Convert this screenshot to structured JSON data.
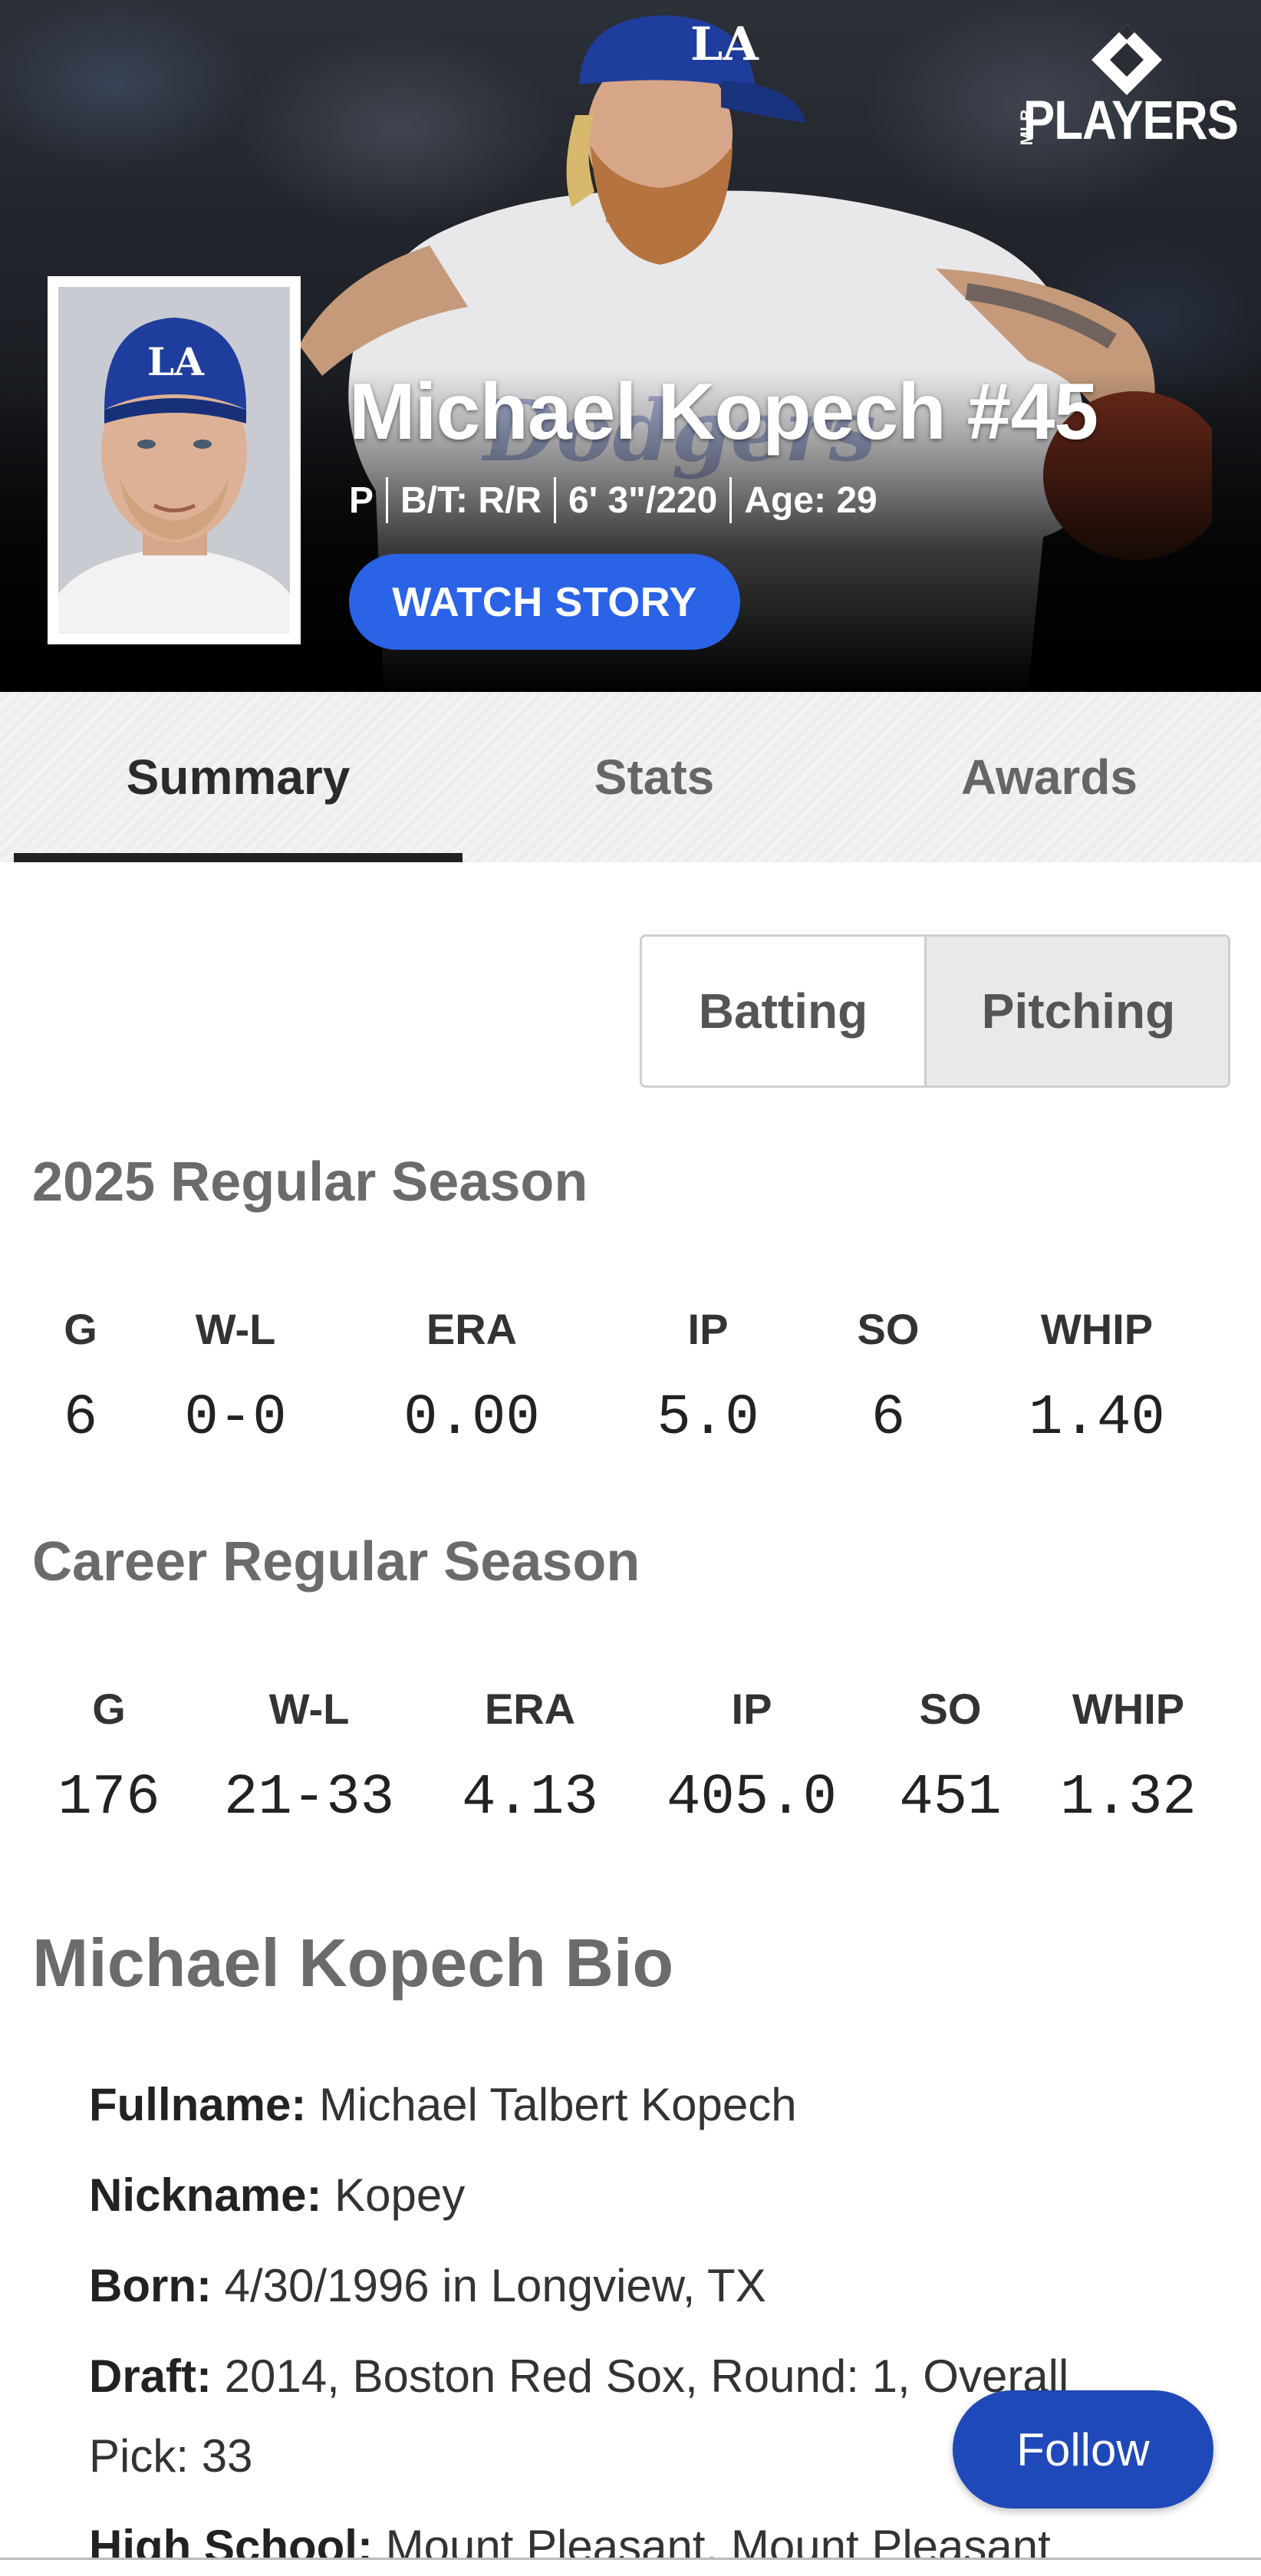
{
  "hero": {
    "logo_text": "PLAYERS",
    "logo_side_text": "MLB",
    "name": "Michael Kopech #45",
    "meta": [
      "P",
      "B/T: R/R",
      "6' 3\"/220",
      "Age: 29"
    ],
    "watch_story": "WATCH STORY"
  },
  "tabs": [
    {
      "label": "Summary",
      "active": true
    },
    {
      "label": "Stats",
      "active": false
    },
    {
      "label": "Awards",
      "active": false
    }
  ],
  "toggle": {
    "batting": "Batting",
    "pitching": "Pitching",
    "selected": "Pitching"
  },
  "season": {
    "title": "2025 Regular Season",
    "stats": [
      {
        "label": "G",
        "value": "6"
      },
      {
        "label": "W-L",
        "value": "0-0"
      },
      {
        "label": "ERA",
        "value": "0.00"
      },
      {
        "label": "IP",
        "value": "5.0"
      },
      {
        "label": "SO",
        "value": "6"
      },
      {
        "label": "WHIP",
        "value": "1.40"
      }
    ]
  },
  "career": {
    "title": "Career Regular Season",
    "stats": [
      {
        "label": "G",
        "value": "176"
      },
      {
        "label": "W-L",
        "value": "21-33"
      },
      {
        "label": "ERA",
        "value": "4.13"
      },
      {
        "label": "IP",
        "value": "405.0"
      },
      {
        "label": "SO",
        "value": "451"
      },
      {
        "label": "WHIP",
        "value": "1.32"
      }
    ]
  },
  "bio": {
    "title": "Michael Kopech Bio",
    "rows": [
      {
        "label": "Fullname:",
        "value": "Michael Talbert Kopech"
      },
      {
        "label": "Nickname:",
        "value": "Kopey"
      },
      {
        "label": "Born:",
        "value": "4/30/1996 in Longview, TX"
      },
      {
        "label": "Draft:",
        "value": "2014, Boston Red Sox, Round: 1, Overall Pick: 33"
      },
      {
        "label": "High School:",
        "value": "Mount Pleasant, Mount Pleasant"
      }
    ]
  },
  "follow": "Follow",
  "colors": {
    "accent": "#2a63e6",
    "follow": "#1f48b8",
    "dodger_blue": "#1f3d9c"
  }
}
